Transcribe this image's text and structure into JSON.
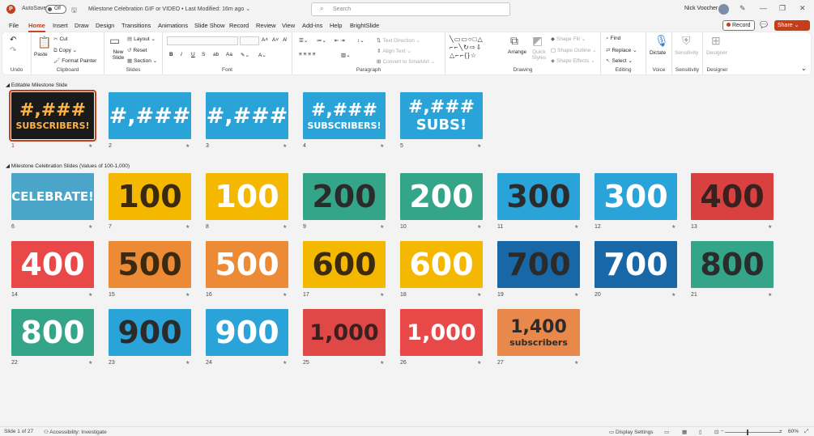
{
  "titlebar": {
    "autosave_label": "AutoSave",
    "autosave_state": "Off",
    "doc_title": "Milestone Celebration GIF or VIDEO • Last Modified: 16m ago ⌄",
    "search_placeholder": "Search",
    "user_name": "Nick Voocher"
  },
  "tabs": [
    "File",
    "Home",
    "Insert",
    "Draw",
    "Design",
    "Transitions",
    "Animations",
    "Slide Show",
    "Record",
    "Review",
    "View",
    "Add-ins",
    "Help",
    "BrightSlide"
  ],
  "active_tab": "Home",
  "record_label": "Record",
  "share_label": "Share",
  "ribbon": {
    "undo": {
      "label": "Undo"
    },
    "clipboard": {
      "label": "Clipboard",
      "paste": "Paste",
      "cut": "Cut",
      "copy": "Copy",
      "format_painter": "Format Painter"
    },
    "slides": {
      "label": "Slides",
      "new_slide": "New Slide",
      "layout": "Layout",
      "reset": "Reset",
      "section": "Section"
    },
    "font": {
      "label": "Font",
      "bold": "B",
      "italic": "I",
      "underline": "U",
      "strike": "S"
    },
    "paragraph": {
      "label": "Paragraph",
      "text_direction": "Text Direction",
      "align_text": "Align Text",
      "smartart": "Convert to SmartArt"
    },
    "drawing": {
      "label": "Drawing",
      "arrange": "Arrange",
      "quick_styles": "Quick Styles",
      "shape_fill": "Shape Fill",
      "shape_outline": "Shape Outline",
      "shape_effects": "Shape Effects"
    },
    "editing": {
      "label": "Editing",
      "find": "Find",
      "replace": "Replace",
      "select": "Select"
    },
    "voice": {
      "label": "Voice",
      "dictate": "Dictate"
    },
    "sensitivity": {
      "label": "Sensitivity",
      "btn": "Sensitivity"
    },
    "designer": {
      "label": "Designer",
      "btn": "Designer"
    }
  },
  "sections": [
    {
      "title": "Editable Milestone Slide"
    },
    {
      "title": "Milestone Celebration Slides (Values of 100-1,000)"
    }
  ],
  "slides": [
    {
      "n": "1",
      "text": "#,###\nSUBSCRIBERS!",
      "bg": "#1a1a1a",
      "fg": "#ffb347"
    },
    {
      "n": "2",
      "text": "#,###",
      "bg": "#2aa3d8",
      "fg": "#ffffff"
    },
    {
      "n": "3",
      "text": "#,###",
      "bg": "#2aa3d8",
      "fg": "#ffffff"
    },
    {
      "n": "4",
      "text": "#,###\nSUBSCRIBERS!",
      "bg": "#2aa3d8",
      "fg": "#ffffff"
    },
    {
      "n": "5",
      "text": "#,###\nSUBS!",
      "bg": "#2aa3d8",
      "fg": "#ffffff"
    },
    {
      "n": "6",
      "text": "CELEBRATE!",
      "bg": "#4aa5c8",
      "fg": "#ffffff"
    },
    {
      "n": "7",
      "text": "100",
      "bg": "#f5b800",
      "fg": "#3b2a10"
    },
    {
      "n": "8",
      "text": "100",
      "bg": "#f5b800",
      "fg": "#ffffff"
    },
    {
      "n": "9",
      "text": "200",
      "bg": "#35a58a",
      "fg": "#2b2b2b"
    },
    {
      "n": "10",
      "text": "200",
      "bg": "#35a58a",
      "fg": "#ffffff"
    },
    {
      "n": "11",
      "text": "300",
      "bg": "#2aa3d8",
      "fg": "#2b2b2b"
    },
    {
      "n": "12",
      "text": "300",
      "bg": "#2aa3d8",
      "fg": "#ffffff"
    },
    {
      "n": "13",
      "text": "400",
      "bg": "#d94040",
      "fg": "#3b2020"
    },
    {
      "n": "14",
      "text": "400",
      "bg": "#e84848",
      "fg": "#ffffff"
    },
    {
      "n": "15",
      "text": "500",
      "bg": "#ec8a35",
      "fg": "#3b2a10"
    },
    {
      "n": "16",
      "text": "500",
      "bg": "#ec8a35",
      "fg": "#ffffff"
    },
    {
      "n": "17",
      "text": "600",
      "bg": "#f5b800",
      "fg": "#3b2a10"
    },
    {
      "n": "18",
      "text": "600",
      "bg": "#f5b800",
      "fg": "#ffffff"
    },
    {
      "n": "19",
      "text": "700",
      "bg": "#1868a8",
      "fg": "#2b2b2b"
    },
    {
      "n": "20",
      "text": "700",
      "bg": "#1868a8",
      "fg": "#ffffff"
    },
    {
      "n": "21",
      "text": "800",
      "bg": "#35a58a",
      "fg": "#2b2b2b"
    },
    {
      "n": "22",
      "text": "800",
      "bg": "#35a58a",
      "fg": "#ffffff"
    },
    {
      "n": "23",
      "text": "900",
      "bg": "#2aa3d8",
      "fg": "#2b2b2b"
    },
    {
      "n": "24",
      "text": "900",
      "bg": "#2aa3d8",
      "fg": "#ffffff"
    },
    {
      "n": "25",
      "text": "1,000",
      "bg": "#e04848",
      "fg": "#3b2020"
    },
    {
      "n": "26",
      "text": "1,000",
      "bg": "#e84848",
      "fg": "#ffffff"
    },
    {
      "n": "27",
      "text": "1,400\nsubscribers",
      "bg": "#e8884a",
      "fg": "#2b2b2b"
    }
  ],
  "status": {
    "slide_info": "Slide 1 of 27",
    "accessibility": "Accessibility: Investigate",
    "display_settings": "Display Settings",
    "zoom": "60%"
  },
  "colors": {
    "accent": "#c43e1c"
  }
}
